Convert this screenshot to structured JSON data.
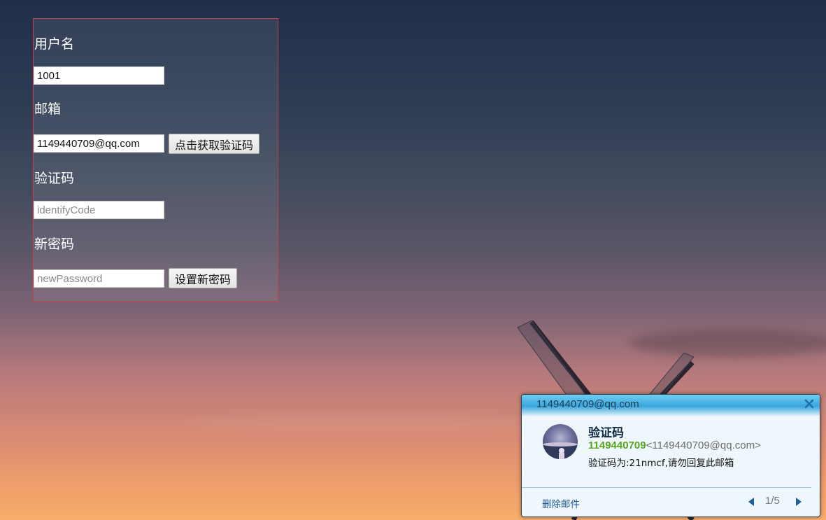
{
  "form": {
    "username_label": "用户名",
    "username_value": "1001",
    "email_label": "邮箱",
    "email_value": "1149440709@qq.com",
    "get_code_button": "点击获取验证码",
    "code_label": "验证码",
    "code_placeholder": "identifyCode",
    "new_password_label": "新密码",
    "new_password_placeholder": "newPassword",
    "set_password_button": "设置新密码"
  },
  "notification": {
    "account": "1149440709@qq.com",
    "subject": "验证码",
    "sender_name": "1149440709",
    "sender_address": "<1149440709@qq.com>",
    "body": "验证码为:21nmcf,请勿回复此邮箱",
    "delete_label": "删除邮件",
    "pager": "1/5"
  },
  "colors": {
    "form_border": "#c9424a",
    "notify_header": "#3aa6dc",
    "sender_name": "#5aa51a",
    "link": "#1d5a8c"
  }
}
